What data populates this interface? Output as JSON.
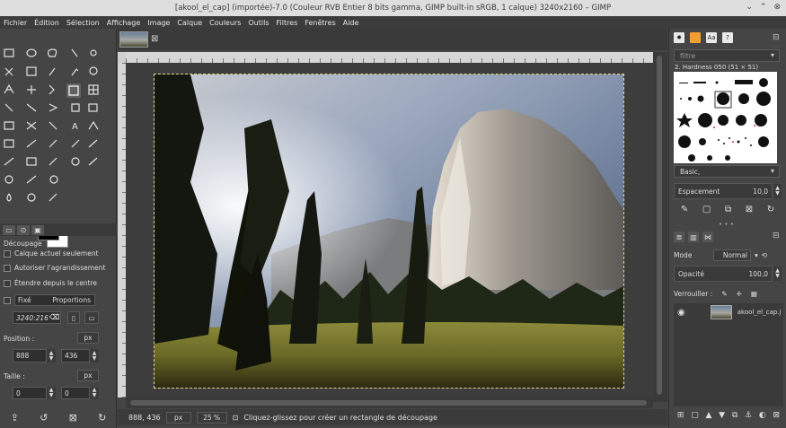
{
  "window": {
    "title": "[akool_el_cap] (importée)-7.0 (Couleur RVB Entier 8 bits gamma, GIMP built-in sRGB, 1 calque) 3240x2160 – GIMP",
    "minimize": "⌄",
    "maximize": "⌃",
    "close": "⊗"
  },
  "menubar": [
    "Fichier",
    "Édition",
    "Sélection",
    "Affichage",
    "Image",
    "Calque",
    "Couleurs",
    "Outils",
    "Filtres",
    "Fenêtres",
    "Aide"
  ],
  "tool_options": {
    "title": "Découpage",
    "opt1": "Calque actuel seulement",
    "opt2": "Autoriser l'agrandissement",
    "opt3": "Étendre depuis le centre",
    "fixed_label": "Fixé",
    "fixed_mode": "Proportions",
    "ratio_value": "3240:216",
    "position_label": "Position :",
    "position_unit": "px",
    "pos_x": "888",
    "pos_y": "436",
    "size_label": "Taille :",
    "size_unit": "px",
    "size_w": "0",
    "size_h": "0"
  },
  "status": {
    "coords": "888, 436",
    "unit": "px",
    "zoom": "25 %",
    "message": "Cliquez-glissez pour créer un rectangle de découpage"
  },
  "brushes": {
    "filter_placeholder": "filtre",
    "current": "2. Hardness 050 (51 × 51)",
    "set": "Basic,",
    "spacing_label": "Espacement",
    "spacing_value": "10,0"
  },
  "layers": {
    "mode_label": "Mode",
    "mode_value": "Normal",
    "opacity_label": "Opacité",
    "opacity_value": "100,0",
    "lock_label": "Verrouiller :",
    "layer_name": "akool_el_cap.j"
  },
  "colors": {
    "accent_dashed": "#e5d98a",
    "panel": "#454545"
  }
}
